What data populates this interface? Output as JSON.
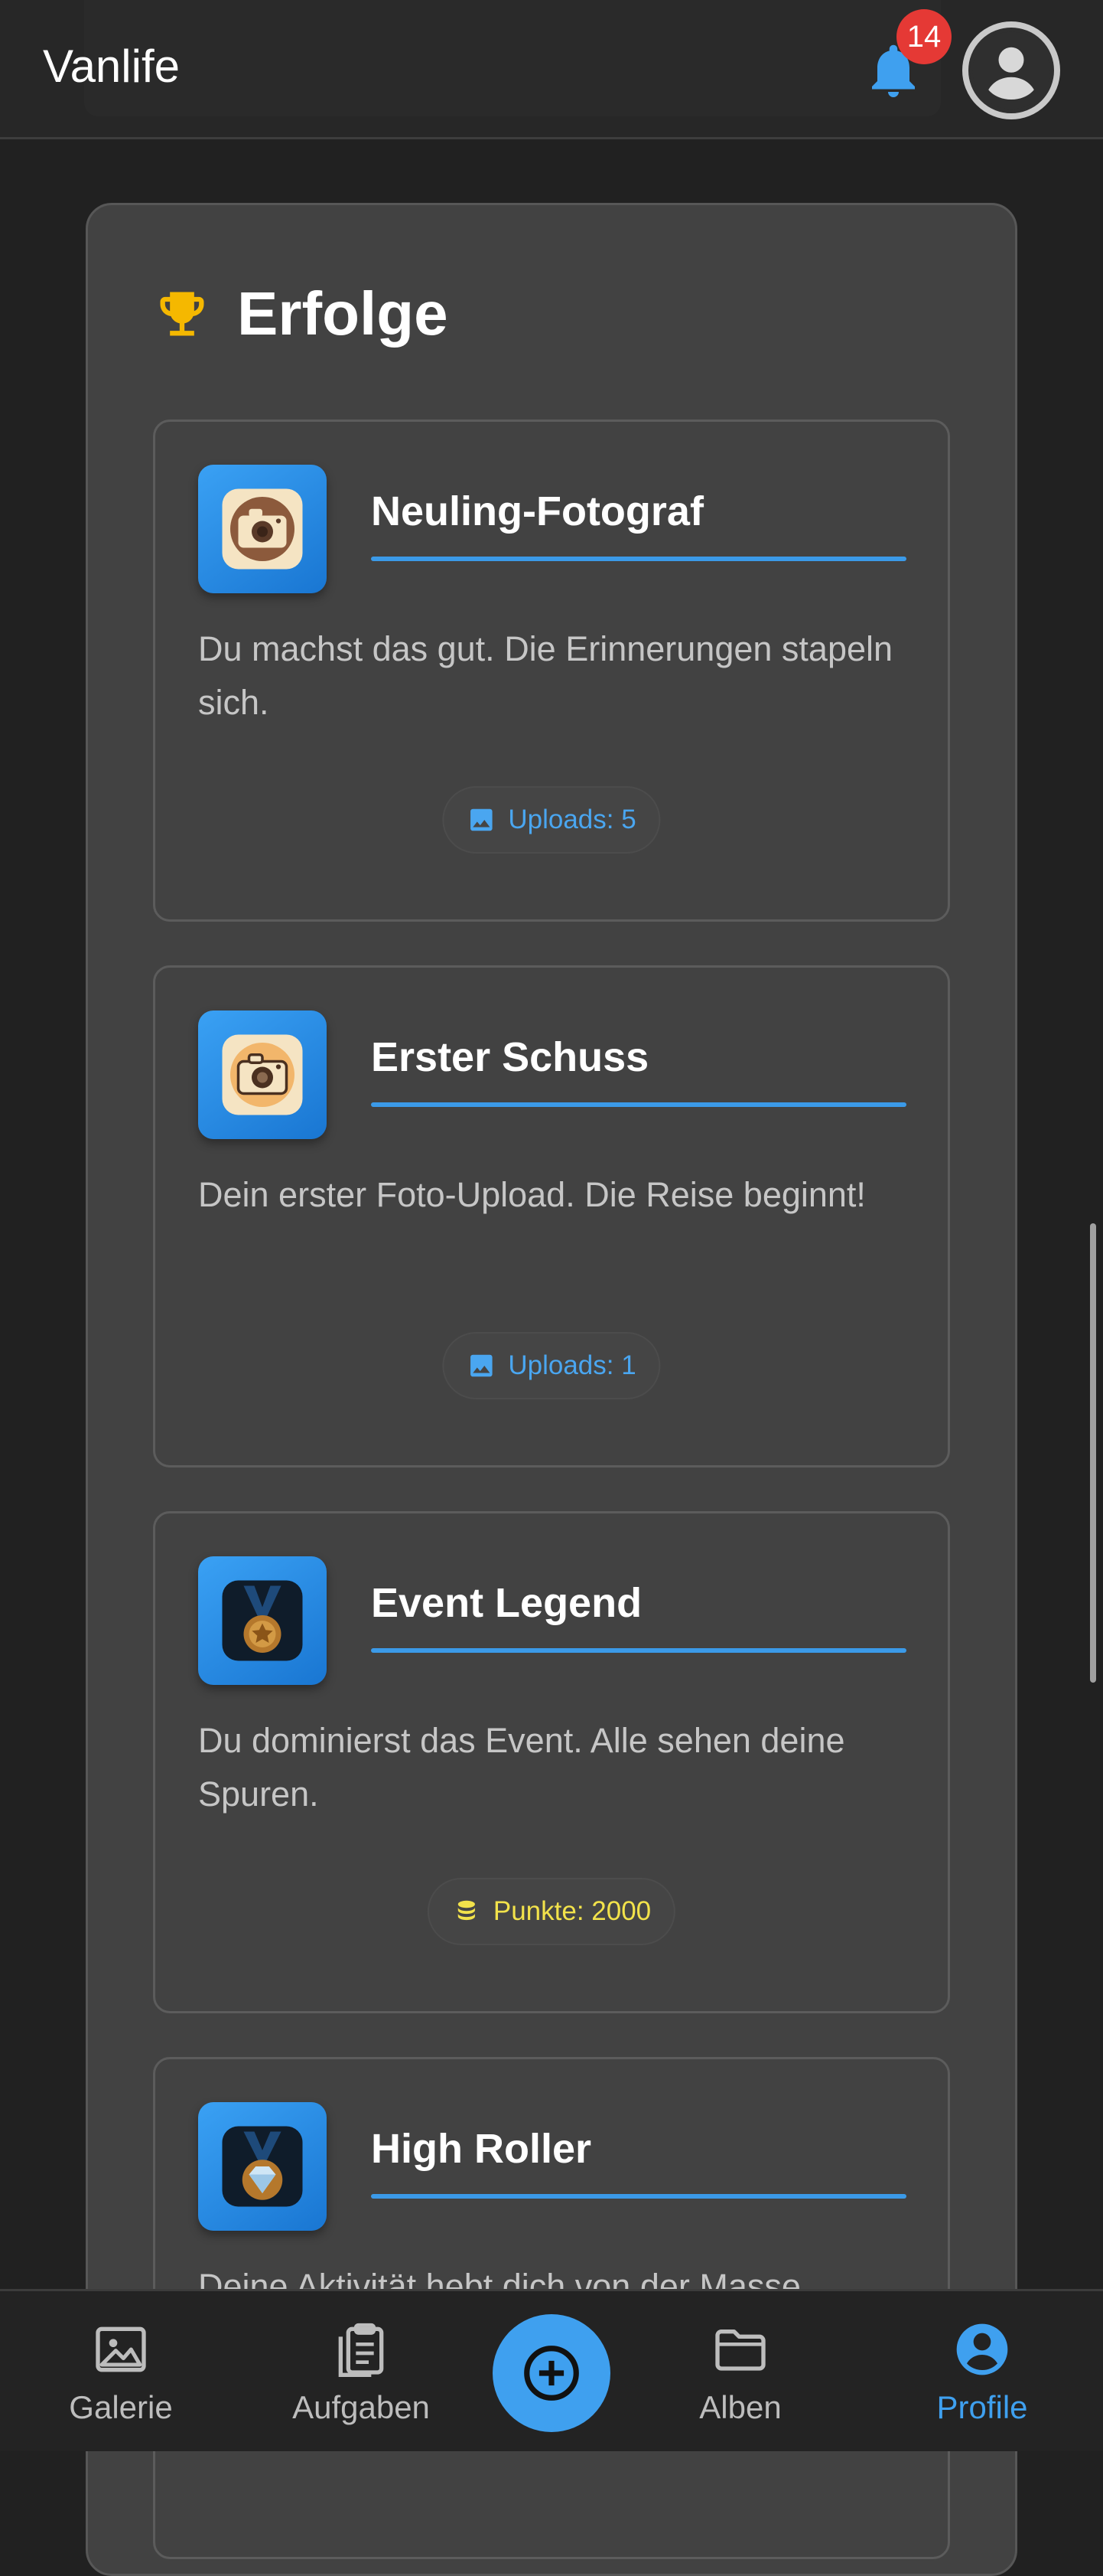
{
  "header": {
    "title": "Vanlife",
    "notification_count": "14"
  },
  "section": {
    "title": "Erfolge"
  },
  "achievements": [
    {
      "title": "Neuling-Fotograf",
      "description": "Du machst das gut. Die Erinnerungen stapeln sich.",
      "chip_label": "Uploads: 5",
      "icon": "camera-icon"
    },
    {
      "title": "Erster Schuss",
      "description": "Dein erster Foto-Upload. Die Reise beginnt!",
      "chip_label": "Uploads: 1",
      "icon": "camera-icon"
    },
    {
      "title": "Event Legend",
      "description": "Du dominierst das Event. Alle sehen deine Spuren.",
      "chip_label": "Punkte: 2000",
      "icon": "medal-icon"
    },
    {
      "title": "High Roller",
      "description": "Deine Aktivität hebt dich von der Masse",
      "icon": "diamond-medal-icon"
    }
  ],
  "nav": {
    "items": [
      {
        "label": "Galerie",
        "icon": "image-icon"
      },
      {
        "label": "Aufgaben",
        "icon": "clipboard-icon"
      },
      {
        "label": "Alben",
        "icon": "folder-icon"
      },
      {
        "label": "Profile",
        "icon": "account-icon",
        "active": true
      }
    ],
    "fab_icon": "plus-circle-icon"
  },
  "colors": {
    "accent": "#3fa0ef",
    "badge": "#e53935",
    "trophy": "#f5b800",
    "points": "#f2e24b",
    "background": "#212121",
    "card": "#424242"
  }
}
